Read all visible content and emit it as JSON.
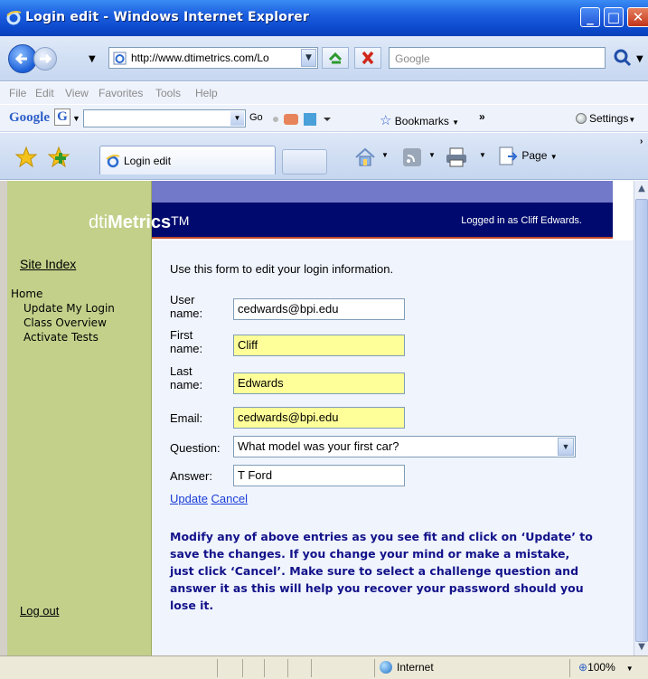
{
  "window": {
    "title": "Login edit - Windows Internet Explorer"
  },
  "address": {
    "url": "http://www.dtimetrics.com/Lo",
    "search_placeholder": "Google"
  },
  "menu": [
    "File",
    "Edit",
    "View",
    "Favorites",
    "Tools",
    "Help"
  ],
  "google_toolbar": {
    "logo": "Google",
    "go_label": "Go",
    "bookmarks_label": "Bookmarks",
    "more_label": "»",
    "settings_label": "Settings"
  },
  "tabs": {
    "active_label": "Login edit"
  },
  "commands": {
    "page_label": "Page"
  },
  "site": {
    "brand_plain": "dti",
    "brand_bold": "Metrics",
    "brand_tm": "TM",
    "logged_in": "Logged in as Cliff Edwards."
  },
  "sidebar": {
    "site_index": "Site Index",
    "home": "Home",
    "items": [
      {
        "label": "Update My Login"
      },
      {
        "label": "Class Overview"
      },
      {
        "label": "Activate Tests"
      }
    ],
    "logout": "Log out"
  },
  "form": {
    "intro": "Use this form to edit your login information.",
    "user_label_1": "User",
    "user_label_2": "name:",
    "user_value": "cedwards@bpi.edu",
    "first_label_1": "First",
    "first_label_2": "name:",
    "first_value": "Cliff",
    "last_label_1": "Last",
    "last_label_2": "name:",
    "last_value": "Edwards",
    "email_label": "Email:",
    "email_value": "cedwards@bpi.edu",
    "question_label": "Question:",
    "question_value": "What model was your first car?",
    "answer_label": "Answer:",
    "answer_value": "T Ford",
    "update_label": "Update",
    "cancel_label": "Cancel",
    "help_text": "Modify any of above entries as you see fit and click on ‘Update’ to save the changes. If you change your mind or make a mistake, just click ‘Cancel’. Make sure to select a challenge question and answer it as this will help you recover your password should you lose it."
  },
  "status": {
    "zone": "Internet",
    "zoom": "100%"
  }
}
